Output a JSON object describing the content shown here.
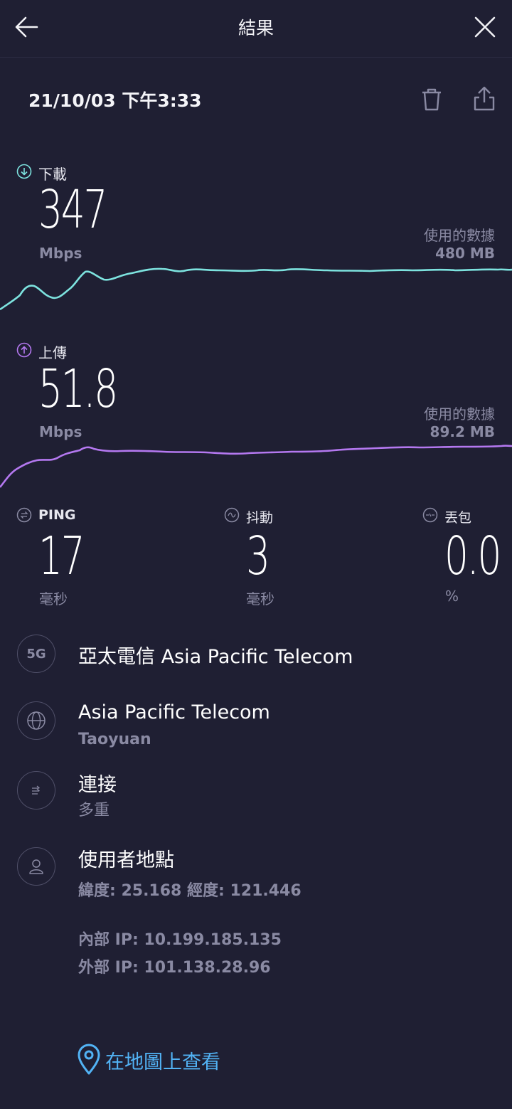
{
  "header": {
    "title": "結果",
    "back_icon": "back-arrow-icon",
    "close_icon": "close-icon"
  },
  "result": {
    "datetime": "21/10/03 下午3:33",
    "delete_icon": "trash-icon",
    "share_icon": "share-icon"
  },
  "download": {
    "label": "下載",
    "value": "347",
    "unit": "Mbps",
    "data_used_label": "使用的數據",
    "data_used": "480 MB",
    "color": "#7de3df"
  },
  "upload": {
    "label": "上傳",
    "value": "51.8",
    "unit": "Mbps",
    "data_used_label": "使用的數據",
    "data_used": "89.2 MB",
    "color": "#b478f0"
  },
  "metrics": {
    "ping": {
      "label": "PING",
      "value": "17",
      "unit": "毫秒"
    },
    "jitter": {
      "label": "抖動",
      "value": "3",
      "unit": "毫秒"
    },
    "loss": {
      "label": "丟包",
      "value": "0.0",
      "unit": "%"
    }
  },
  "info": {
    "carrier": {
      "badge": "5G",
      "name": "亞太電信 Asia Pacific Telecom"
    },
    "server": {
      "name": "Asia Pacific Telecom",
      "location": "Taoyuan"
    },
    "connection": {
      "label": "連接",
      "value": "多重"
    },
    "user_location": {
      "label": "使用者地點",
      "coords": "緯度: 25.168 經度: 121.446"
    },
    "internal_ip": "內部 IP: 10.199.185.135",
    "external_ip": "外部 IP: 101.138.28.96"
  },
  "map_link": {
    "label": "在地圖上查看"
  },
  "colors": {
    "background": "#1f1f33",
    "muted_text": "#8a8aa3",
    "link": "#52b3f5"
  }
}
